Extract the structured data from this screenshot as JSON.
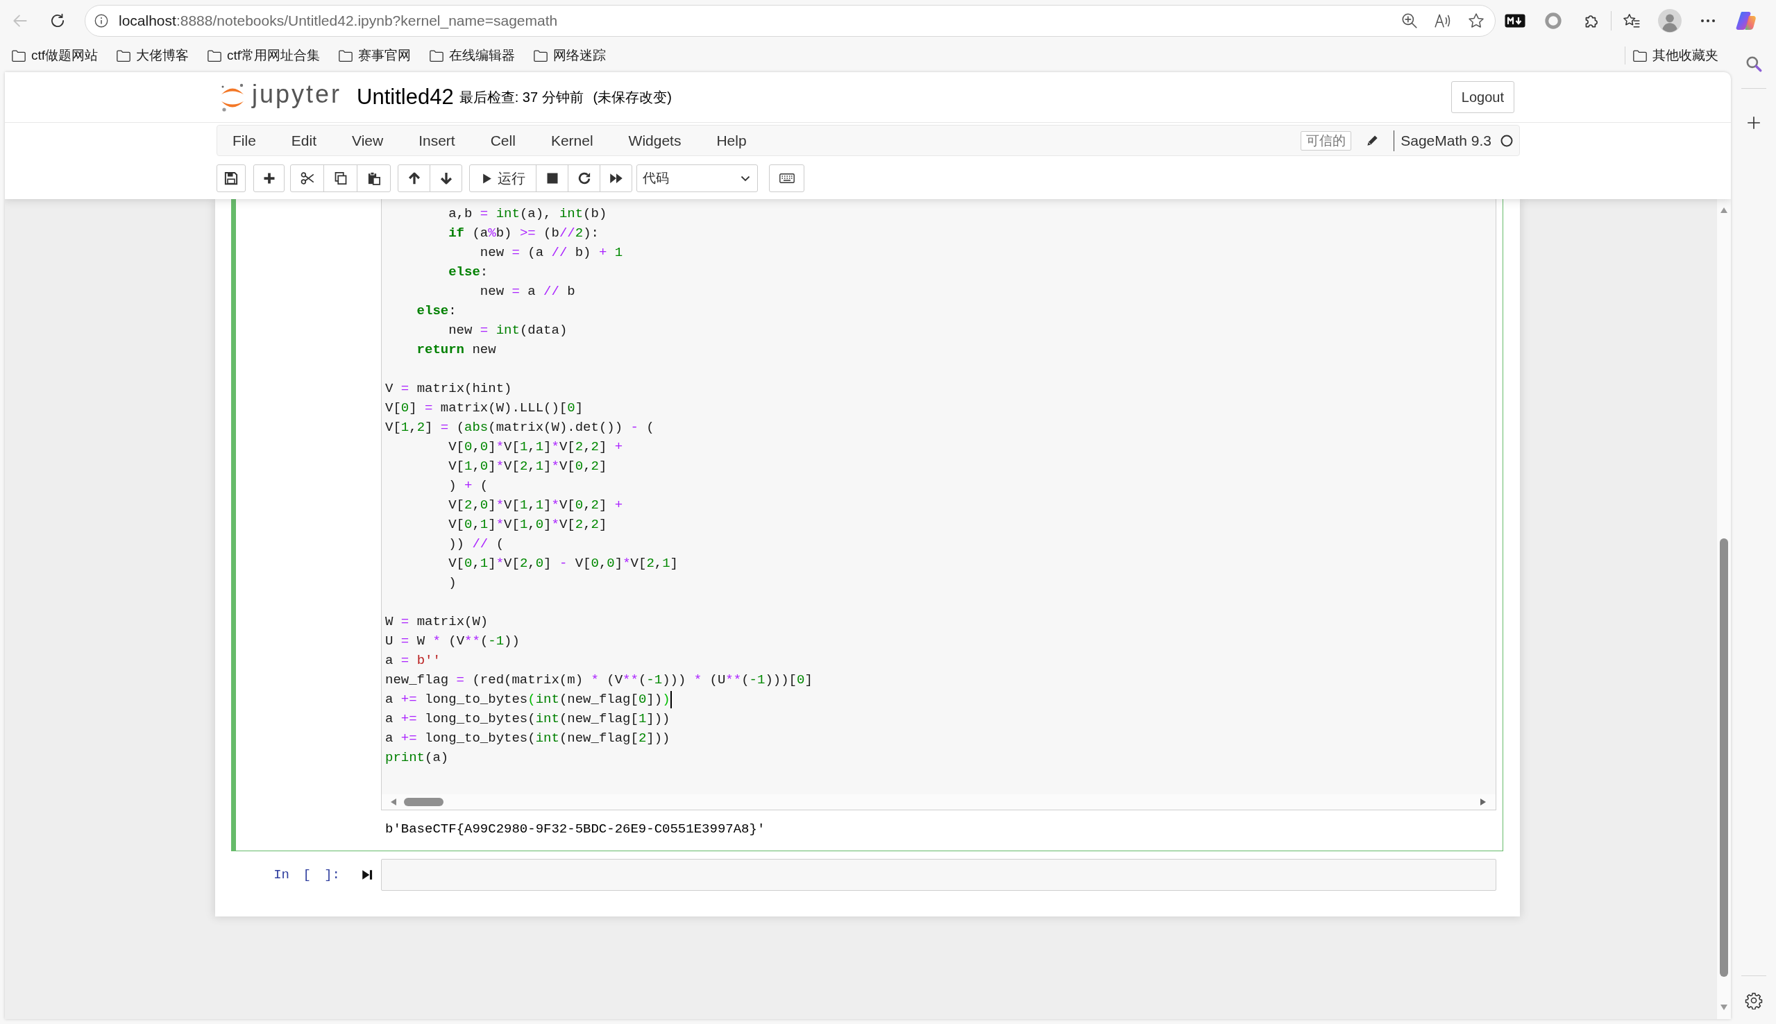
{
  "browser": {
    "back_button": {
      "disabled": true
    },
    "url": {
      "host": "localhost",
      "path": ":8888/notebooks/Untitled42.ipynb?kernel_name=sagemath"
    },
    "bookmarks": [
      {
        "label": "ctf做题网站"
      },
      {
        "label": "大佬博客"
      },
      {
        "label": "ctf常用网址合集"
      },
      {
        "label": "赛事官网"
      },
      {
        "label": "在线编辑器"
      },
      {
        "label": "网络迷踪"
      }
    ],
    "other_bookmarks": "其他收藏夹"
  },
  "header": {
    "logo_text": "jupyter",
    "notebook_name": "Untitled42",
    "checkpoint": "最后检查: 37 分钟前",
    "autosave": "(未保存改变)",
    "logout": "Logout"
  },
  "menu": {
    "items": [
      "File",
      "Edit",
      "View",
      "Insert",
      "Cell",
      "Kernel",
      "Widgets",
      "Help"
    ],
    "trusted": "可信的",
    "kernel_name": "SageMath 9.3",
    "kernel_busy": false
  },
  "toolbar": {
    "run_label": "运行",
    "cell_type": "代码"
  },
  "cells": [
    {
      "kind": "code",
      "selected": true,
      "blocks": [
        {
          "lines": [
            {
              "cursor": false,
              "tokens": [
                {
                  "text": "        a,b",
                  "kind": "plain"
                },
                {
                  "text": " = ",
                  "kind": "operator"
                },
                {
                  "text": "int",
                  "kind": "builtin"
                },
                {
                  "text": "(a), ",
                  "kind": "plain"
                },
                {
                  "text": "int",
                  "kind": "builtin"
                },
                {
                  "text": "(b)",
                  "kind": "plain"
                }
              ]
            },
            {
              "cursor": false,
              "tokens": [
                {
                  "text": "        if",
                  "kind": "keyword"
                },
                {
                  "text": " (a",
                  "kind": "plain"
                },
                {
                  "text": "%",
                  "kind": "operator"
                },
                {
                  "text": "b) ",
                  "kind": "plain"
                },
                {
                  "text": ">=",
                  "kind": "operator"
                },
                {
                  "text": " (b",
                  "kind": "plain"
                },
                {
                  "text": "//",
                  "kind": "operator"
                },
                {
                  "text": "2",
                  "kind": "number"
                },
                {
                  "text": "):",
                  "kind": "plain"
                }
              ]
            },
            {
              "cursor": false,
              "tokens": [
                {
                  "text": "            new",
                  "kind": "plain"
                },
                {
                  "text": " = ",
                  "kind": "operator"
                },
                {
                  "text": "(a ",
                  "kind": "plain"
                },
                {
                  "text": "//",
                  "kind": "operator"
                },
                {
                  "text": " b) ",
                  "kind": "plain"
                },
                {
                  "text": "+ ",
                  "kind": "operator"
                },
                {
                  "text": "1",
                  "kind": "number"
                }
              ]
            },
            {
              "cursor": false,
              "tokens": [
                {
                  "text": "        else",
                  "kind": "keyword"
                },
                {
                  "text": ":",
                  "kind": "plain"
                }
              ]
            },
            {
              "cursor": false,
              "tokens": [
                {
                  "text": "            new",
                  "kind": "plain"
                },
                {
                  "text": " = ",
                  "kind": "operator"
                },
                {
                  "text": "a ",
                  "kind": "plain"
                },
                {
                  "text": "//",
                  "kind": "operator"
                },
                {
                  "text": " b",
                  "kind": "plain"
                }
              ]
            },
            {
              "cursor": false,
              "tokens": [
                {
                  "text": "    else",
                  "kind": "keyword"
                },
                {
                  "text": ":",
                  "kind": "plain"
                }
              ]
            },
            {
              "cursor": false,
              "tokens": [
                {
                  "text": "        new",
                  "kind": "plain"
                },
                {
                  "text": " = ",
                  "kind": "operator"
                },
                {
                  "text": "int",
                  "kind": "builtin"
                },
                {
                  "text": "(data)",
                  "kind": "plain"
                }
              ]
            },
            {
              "cursor": false,
              "tokens": [
                {
                  "text": "    return",
                  "kind": "keyword"
                },
                {
                  "text": " new",
                  "kind": "plain"
                }
              ]
            }
          ]
        },
        {
          "lines": [
            {
              "cursor": false,
              "tokens": [
                {
                  "text": "V",
                  "kind": "plain"
                },
                {
                  "text": " = ",
                  "kind": "operator"
                },
                {
                  "text": "matrix(hint)",
                  "kind": "plain"
                }
              ]
            },
            {
              "cursor": false,
              "tokens": [
                {
                  "text": "V[",
                  "kind": "plain"
                },
                {
                  "text": "0",
                  "kind": "number"
                },
                {
                  "text": "]",
                  "kind": "plain"
                },
                {
                  "text": " = ",
                  "kind": "operator"
                },
                {
                  "text": "matrix(W).LLL()[",
                  "kind": "plain"
                },
                {
                  "text": "0",
                  "kind": "number"
                },
                {
                  "text": "]",
                  "kind": "plain"
                }
              ]
            },
            {
              "cursor": false,
              "tokens": [
                {
                  "text": "V[",
                  "kind": "plain"
                },
                {
                  "text": "1",
                  "kind": "number"
                },
                {
                  "text": ",",
                  "kind": "plain"
                },
                {
                  "text": "2",
                  "kind": "number"
                },
                {
                  "text": "]",
                  "kind": "plain"
                },
                {
                  "text": " = ",
                  "kind": "operator"
                },
                {
                  "text": "(",
                  "kind": "plain"
                },
                {
                  "text": "abs",
                  "kind": "builtin"
                },
                {
                  "text": "(matrix(W).det()) ",
                  "kind": "plain"
                },
                {
                  "text": "- ",
                  "kind": "operator"
                },
                {
                  "text": "(",
                  "kind": "plain"
                }
              ]
            },
            {
              "cursor": false,
              "tokens": [
                {
                  "text": "        V[",
                  "kind": "plain"
                },
                {
                  "text": "0",
                  "kind": "number"
                },
                {
                  "text": ",",
                  "kind": "plain"
                },
                {
                  "text": "0",
                  "kind": "number"
                },
                {
                  "text": "]",
                  "kind": "plain"
                },
                {
                  "text": "*",
                  "kind": "operator"
                },
                {
                  "text": "V[",
                  "kind": "plain"
                },
                {
                  "text": "1",
                  "kind": "number"
                },
                {
                  "text": ",",
                  "kind": "plain"
                },
                {
                  "text": "1",
                  "kind": "number"
                },
                {
                  "text": "]",
                  "kind": "plain"
                },
                {
                  "text": "*",
                  "kind": "operator"
                },
                {
                  "text": "V[",
                  "kind": "plain"
                },
                {
                  "text": "2",
                  "kind": "number"
                },
                {
                  "text": ",",
                  "kind": "plain"
                },
                {
                  "text": "2",
                  "kind": "number"
                },
                {
                  "text": "] ",
                  "kind": "plain"
                },
                {
                  "text": "+",
                  "kind": "operator"
                }
              ]
            },
            {
              "cursor": false,
              "tokens": [
                {
                  "text": "        V[",
                  "kind": "plain"
                },
                {
                  "text": "1",
                  "kind": "number"
                },
                {
                  "text": ",",
                  "kind": "plain"
                },
                {
                  "text": "0",
                  "kind": "number"
                },
                {
                  "text": "]",
                  "kind": "plain"
                },
                {
                  "text": "*",
                  "kind": "operator"
                },
                {
                  "text": "V[",
                  "kind": "plain"
                },
                {
                  "text": "2",
                  "kind": "number"
                },
                {
                  "text": ",",
                  "kind": "plain"
                },
                {
                  "text": "1",
                  "kind": "number"
                },
                {
                  "text": "]",
                  "kind": "plain"
                },
                {
                  "text": "*",
                  "kind": "operator"
                },
                {
                  "text": "V[",
                  "kind": "plain"
                },
                {
                  "text": "0",
                  "kind": "number"
                },
                {
                  "text": ",",
                  "kind": "plain"
                },
                {
                  "text": "2",
                  "kind": "number"
                },
                {
                  "text": "]",
                  "kind": "plain"
                }
              ]
            },
            {
              "cursor": false,
              "tokens": [
                {
                  "text": "        ) ",
                  "kind": "plain"
                },
                {
                  "text": "+",
                  "kind": "operator"
                },
                {
                  "text": " (",
                  "kind": "plain"
                }
              ]
            },
            {
              "cursor": false,
              "tokens": [
                {
                  "text": "        V[",
                  "kind": "plain"
                },
                {
                  "text": "2",
                  "kind": "number"
                },
                {
                  "text": ",",
                  "kind": "plain"
                },
                {
                  "text": "0",
                  "kind": "number"
                },
                {
                  "text": "]",
                  "kind": "plain"
                },
                {
                  "text": "*",
                  "kind": "operator"
                },
                {
                  "text": "V[",
                  "kind": "plain"
                },
                {
                  "text": "1",
                  "kind": "number"
                },
                {
                  "text": ",",
                  "kind": "plain"
                },
                {
                  "text": "1",
                  "kind": "number"
                },
                {
                  "text": "]",
                  "kind": "plain"
                },
                {
                  "text": "*",
                  "kind": "operator"
                },
                {
                  "text": "V[",
                  "kind": "plain"
                },
                {
                  "text": "0",
                  "kind": "number"
                },
                {
                  "text": ",",
                  "kind": "plain"
                },
                {
                  "text": "2",
                  "kind": "number"
                },
                {
                  "text": "] ",
                  "kind": "plain"
                },
                {
                  "text": "+",
                  "kind": "operator"
                }
              ]
            },
            {
              "cursor": false,
              "tokens": [
                {
                  "text": "        V[",
                  "kind": "plain"
                },
                {
                  "text": "0",
                  "kind": "number"
                },
                {
                  "text": ",",
                  "kind": "plain"
                },
                {
                  "text": "1",
                  "kind": "number"
                },
                {
                  "text": "]",
                  "kind": "plain"
                },
                {
                  "text": "*",
                  "kind": "operator"
                },
                {
                  "text": "V[",
                  "kind": "plain"
                },
                {
                  "text": "1",
                  "kind": "number"
                },
                {
                  "text": ",",
                  "kind": "plain"
                },
                {
                  "text": "0",
                  "kind": "number"
                },
                {
                  "text": "]",
                  "kind": "plain"
                },
                {
                  "text": "*",
                  "kind": "operator"
                },
                {
                  "text": "V[",
                  "kind": "plain"
                },
                {
                  "text": "2",
                  "kind": "number"
                },
                {
                  "text": ",",
                  "kind": "plain"
                },
                {
                  "text": "2",
                  "kind": "number"
                },
                {
                  "text": "]",
                  "kind": "plain"
                }
              ]
            },
            {
              "cursor": false,
              "tokens": [
                {
                  "text": "        )) ",
                  "kind": "plain"
                },
                {
                  "text": "//",
                  "kind": "operator"
                },
                {
                  "text": " (",
                  "kind": "plain"
                }
              ]
            },
            {
              "cursor": false,
              "tokens": [
                {
                  "text": "        V[",
                  "kind": "plain"
                },
                {
                  "text": "0",
                  "kind": "number"
                },
                {
                  "text": ",",
                  "kind": "plain"
                },
                {
                  "text": "1",
                  "kind": "number"
                },
                {
                  "text": "]",
                  "kind": "plain"
                },
                {
                  "text": "*",
                  "kind": "operator"
                },
                {
                  "text": "V[",
                  "kind": "plain"
                },
                {
                  "text": "2",
                  "kind": "number"
                },
                {
                  "text": ",",
                  "kind": "plain"
                },
                {
                  "text": "0",
                  "kind": "number"
                },
                {
                  "text": "] ",
                  "kind": "plain"
                },
                {
                  "text": "- ",
                  "kind": "operator"
                },
                {
                  "text": "V[",
                  "kind": "plain"
                },
                {
                  "text": "0",
                  "kind": "number"
                },
                {
                  "text": ",",
                  "kind": "plain"
                },
                {
                  "text": "0",
                  "kind": "number"
                },
                {
                  "text": "]",
                  "kind": "plain"
                },
                {
                  "text": "*",
                  "kind": "operator"
                },
                {
                  "text": "V[",
                  "kind": "plain"
                },
                {
                  "text": "2",
                  "kind": "number"
                },
                {
                  "text": ",",
                  "kind": "plain"
                },
                {
                  "text": "1",
                  "kind": "number"
                },
                {
                  "text": "]",
                  "kind": "plain"
                }
              ]
            },
            {
              "cursor": false,
              "tokens": [
                {
                  "text": "        )",
                  "kind": "plain"
                }
              ]
            }
          ]
        },
        {
          "lines": [
            {
              "cursor": false,
              "tokens": [
                {
                  "text": "W",
                  "kind": "plain"
                },
                {
                  "text": " = ",
                  "kind": "operator"
                },
                {
                  "text": "matrix(W)",
                  "kind": "plain"
                }
              ]
            },
            {
              "cursor": false,
              "tokens": [
                {
                  "text": "U",
                  "kind": "plain"
                },
                {
                  "text": " = ",
                  "kind": "operator"
                },
                {
                  "text": "W ",
                  "kind": "plain"
                },
                {
                  "text": "*",
                  "kind": "operator"
                },
                {
                  "text": " (V",
                  "kind": "plain"
                },
                {
                  "text": "**",
                  "kind": "operator"
                },
                {
                  "text": "(",
                  "kind": "plain"
                },
                {
                  "text": "-1",
                  "kind": "number"
                },
                {
                  "text": "))",
                  "kind": "plain"
                }
              ]
            },
            {
              "cursor": false,
              "tokens": [
                {
                  "text": "a",
                  "kind": "plain"
                },
                {
                  "text": " = ",
                  "kind": "operator"
                },
                {
                  "text": "b''",
                  "kind": "string"
                }
              ]
            },
            {
              "cursor": false,
              "tokens": [
                {
                  "text": "new_flag",
                  "kind": "plain"
                },
                {
                  "text": " = ",
                  "kind": "operator"
                },
                {
                  "text": "(red(matrix(m) ",
                  "kind": "plain"
                },
                {
                  "text": "*",
                  "kind": "operator"
                },
                {
                  "text": " (V",
                  "kind": "plain"
                },
                {
                  "text": "**",
                  "kind": "operator"
                },
                {
                  "text": "(",
                  "kind": "plain"
                },
                {
                  "text": "-1",
                  "kind": "number"
                },
                {
                  "text": "))) ",
                  "kind": "plain"
                },
                {
                  "text": "*",
                  "kind": "operator"
                },
                {
                  "text": " (U",
                  "kind": "plain"
                },
                {
                  "text": "**",
                  "kind": "operator"
                },
                {
                  "text": "(",
                  "kind": "plain"
                },
                {
                  "text": "-1",
                  "kind": "number"
                },
                {
                  "text": ")))[",
                  "kind": "plain"
                },
                {
                  "text": "0",
                  "kind": "number"
                },
                {
                  "text": "]",
                  "kind": "plain"
                }
              ]
            },
            {
              "cursor": true,
              "tokens": [
                {
                  "text": "a ",
                  "kind": "plain"
                },
                {
                  "text": "+=",
                  "kind": "operator"
                },
                {
                  "text": " long_to_bytes",
                  "kind": "plain"
                },
                {
                  "text": "(",
                  "kind": "bracket_match"
                },
                {
                  "text": "int",
                  "kind": "builtin"
                },
                {
                  "text": "(new_flag[",
                  "kind": "plain"
                },
                {
                  "text": "0",
                  "kind": "number"
                },
                {
                  "text": "])",
                  "kind": "plain"
                },
                {
                  "text": ")",
                  "kind": "bracket_match"
                }
              ]
            },
            {
              "cursor": false,
              "tokens": [
                {
                  "text": "a ",
                  "kind": "plain"
                },
                {
                  "text": "+=",
                  "kind": "operator"
                },
                {
                  "text": " long_to_bytes(",
                  "kind": "plain"
                },
                {
                  "text": "int",
                  "kind": "builtin"
                },
                {
                  "text": "(new_flag[",
                  "kind": "plain"
                },
                {
                  "text": "1",
                  "kind": "number"
                },
                {
                  "text": "]))",
                  "kind": "plain"
                }
              ]
            },
            {
              "cursor": false,
              "tokens": [
                {
                  "text": "a ",
                  "kind": "plain"
                },
                {
                  "text": "+=",
                  "kind": "operator"
                },
                {
                  "text": " long_to_bytes(",
                  "kind": "plain"
                },
                {
                  "text": "int",
                  "kind": "builtin"
                },
                {
                  "text": "(new_flag[",
                  "kind": "plain"
                },
                {
                  "text": "2",
                  "kind": "number"
                },
                {
                  "text": "]))",
                  "kind": "plain"
                }
              ]
            },
            {
              "cursor": false,
              "tokens": [
                {
                  "text": "print",
                  "kind": "builtin"
                },
                {
                  "text": "(a)",
                  "kind": "plain"
                }
              ]
            }
          ]
        }
      ],
      "output": "b'BaseCTF{A99C2980-9F32-5BDC-26E9-C0551E3997A8}'"
    },
    {
      "kind": "code",
      "selected": false,
      "prompt": "In [ ]:"
    }
  ]
}
